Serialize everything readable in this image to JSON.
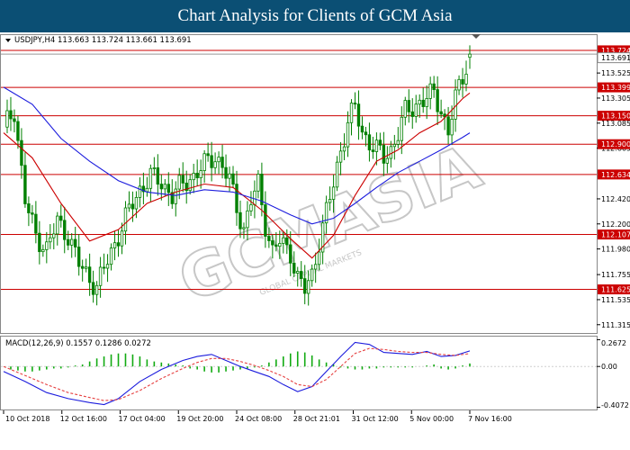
{
  "header": {
    "title": "Chart Analysis for Clients of GCM Asia"
  },
  "watermark": {
    "text": "GCMASIA",
    "subtext": "GLOBAL CAPITAL MARKETS"
  },
  "colors": {
    "header_bg": "#0b4f74",
    "candle": "#008000",
    "sma_fast": "#cc0000",
    "sma_slow": "#1c1cdd",
    "level_line": "#cc0000",
    "macd_hist": "#11aa11",
    "macd_signal": "#e64040"
  },
  "chart_data": [
    {
      "type": "candlestick",
      "header_text": "USDJPY,H4  113.663 113.724 113.661 113.691",
      "symbol": "USDJPY",
      "timeframe": "H4",
      "ohlc_last": {
        "open": 113.663,
        "high": 113.724,
        "low": 113.661,
        "close": 113.691
      },
      "ylim": [
        111.25,
        113.85
      ],
      "y_ticks": [
        "113.525",
        "113.305",
        "113.085",
        "112.865",
        "112.420",
        "112.200",
        "111.980",
        "111.755",
        "111.535",
        "111.315"
      ],
      "price_tags": [
        "113.724",
        "113.691",
        "113.399",
        "113.150",
        "112.900",
        "112.634",
        "112.107",
        "111.625"
      ],
      "horizontal_levels": [
        113.724,
        113.399,
        113.15,
        112.9,
        112.634,
        112.107,
        111.625
      ],
      "x_tick_labels": [
        "10 Oct 2018",
        "12 Oct 16:00",
        "17 Oct 04:00",
        "19 Oct 20:00",
        "24 Oct 08:00",
        "28 Oct 21:01",
        "31 Oct 12:00",
        "5 Nov 00:00",
        "7 Nov 16:00"
      ],
      "close_path": [
        [
          0,
          113.05
        ],
        [
          3,
          113.2
        ],
        [
          6,
          112.4
        ],
        [
          9,
          112.1
        ],
        [
          12,
          111.98
        ],
        [
          15,
          112.22
        ],
        [
          18,
          112.1
        ],
        [
          21,
          111.85
        ],
        [
          24,
          111.72
        ],
        [
          26,
          111.65
        ],
        [
          29,
          111.88
        ],
        [
          32,
          112.1
        ],
        [
          35,
          112.32
        ],
        [
          38,
          112.5
        ],
        [
          41,
          112.62
        ],
        [
          44,
          112.56
        ],
        [
          47,
          112.45
        ],
        [
          50,
          112.55
        ],
        [
          53,
          112.62
        ],
        [
          56,
          112.72
        ],
        [
          59,
          112.8
        ],
        [
          61,
          112.7
        ],
        [
          63,
          112.58
        ],
        [
          65,
          112.35
        ],
        [
          67,
          112.15
        ],
        [
          69,
          112.4
        ],
        [
          71,
          112.55
        ],
        [
          73,
          112.2
        ],
        [
          75,
          111.95
        ],
        [
          77,
          112.05
        ],
        [
          80,
          111.95
        ],
        [
          82,
          111.72
        ],
        [
          84,
          111.62
        ],
        [
          86,
          111.75
        ],
        [
          88,
          112.05
        ],
        [
          90,
          112.3
        ],
        [
          92,
          112.55
        ],
        [
          94,
          112.85
        ],
        [
          96,
          113.1
        ],
        [
          98,
          113.22
        ],
        [
          100,
          113.0
        ],
        [
          102,
          112.92
        ],
        [
          104,
          112.85
        ],
        [
          106,
          112.78
        ],
        [
          108,
          112.85
        ],
        [
          110,
          113.0
        ],
        [
          112,
          113.18
        ],
        [
          114,
          113.22
        ],
        [
          116,
          113.27
        ],
        [
          118,
          113.3
        ],
        [
          120,
          113.35
        ],
        [
          122,
          113.2
        ],
        [
          124,
          113.0
        ],
        [
          126,
          113.3
        ],
        [
          128,
          113.5
        ],
        [
          130,
          113.69
        ]
      ],
      "sma_fast_path": [
        [
          0,
          113.0
        ],
        [
          8,
          112.78
        ],
        [
          16,
          112.38
        ],
        [
          24,
          112.05
        ],
        [
          32,
          112.15
        ],
        [
          40,
          112.38
        ],
        [
          48,
          112.48
        ],
        [
          56,
          112.55
        ],
        [
          64,
          112.52
        ],
        [
          72,
          112.32
        ],
        [
          80,
          112.07
        ],
        [
          86,
          111.9
        ],
        [
          92,
          112.1
        ],
        [
          98,
          112.45
        ],
        [
          104,
          112.75
        ],
        [
          110,
          112.85
        ],
        [
          116,
          113.0
        ],
        [
          122,
          113.1
        ],
        [
          128,
          113.3
        ],
        [
          130,
          113.35
        ]
      ],
      "sma_slow_path": [
        [
          0,
          113.4
        ],
        [
          8,
          113.25
        ],
        [
          16,
          112.95
        ],
        [
          24,
          112.75
        ],
        [
          32,
          112.58
        ],
        [
          40,
          112.48
        ],
        [
          48,
          112.45
        ],
        [
          56,
          112.5
        ],
        [
          64,
          112.48
        ],
        [
          72,
          112.4
        ],
        [
          80,
          112.28
        ],
        [
          86,
          112.2
        ],
        [
          92,
          112.25
        ],
        [
          98,
          112.38
        ],
        [
          104,
          112.52
        ],
        [
          110,
          112.65
        ],
        [
          116,
          112.75
        ],
        [
          122,
          112.85
        ],
        [
          128,
          112.96
        ],
        [
          130,
          113.0
        ]
      ]
    },
    {
      "type": "macd",
      "header_text": "MACD(12,26,9)  0.1557 0.1286 0.0272",
      "params": [
        12,
        26,
        9
      ],
      "values": {
        "macd": 0.1557,
        "signal": 0.1286,
        "histogram": 0.0272
      },
      "ylim": [
        -0.42,
        0.28
      ],
      "y_ticks": [
        "0.2672",
        "0.00",
        "-0.4072"
      ],
      "macd_path": [
        [
          0,
          -0.05
        ],
        [
          6,
          -0.15
        ],
        [
          12,
          -0.26
        ],
        [
          18,
          -0.32
        ],
        [
          24,
          -0.36
        ],
        [
          28,
          -0.38
        ],
        [
          32,
          -0.32
        ],
        [
          38,
          -0.15
        ],
        [
          44,
          -0.03
        ],
        [
          50,
          0.06
        ],
        [
          54,
          0.1
        ],
        [
          58,
          0.12
        ],
        [
          62,
          0.06
        ],
        [
          66,
          0.0
        ],
        [
          70,
          -0.05
        ],
        [
          74,
          -0.1
        ],
        [
          78,
          -0.18
        ],
        [
          82,
          -0.25
        ],
        [
          86,
          -0.2
        ],
        [
          90,
          -0.05
        ],
        [
          94,
          0.1
        ],
        [
          98,
          0.24
        ],
        [
          102,
          0.22
        ],
        [
          106,
          0.14
        ],
        [
          110,
          0.13
        ],
        [
          114,
          0.12
        ],
        [
          118,
          0.15
        ],
        [
          122,
          0.1
        ],
        [
          126,
          0.11
        ],
        [
          130,
          0.155
        ]
      ],
      "signal_path": [
        [
          0,
          0.0
        ],
        [
          6,
          -0.09
        ],
        [
          12,
          -0.18
        ],
        [
          18,
          -0.26
        ],
        [
          24,
          -0.31
        ],
        [
          28,
          -0.34
        ],
        [
          32,
          -0.33
        ],
        [
          38,
          -0.24
        ],
        [
          44,
          -0.12
        ],
        [
          50,
          -0.02
        ],
        [
          54,
          0.04
        ],
        [
          58,
          0.08
        ],
        [
          62,
          0.08
        ],
        [
          66,
          0.05
        ],
        [
          70,
          0.01
        ],
        [
          74,
          -0.04
        ],
        [
          78,
          -0.1
        ],
        [
          82,
          -0.18
        ],
        [
          86,
          -0.2
        ],
        [
          90,
          -0.13
        ],
        [
          94,
          0.0
        ],
        [
          98,
          0.13
        ],
        [
          102,
          0.18
        ],
        [
          106,
          0.17
        ],
        [
          110,
          0.15
        ],
        [
          114,
          0.14
        ],
        [
          118,
          0.14
        ],
        [
          122,
          0.12
        ],
        [
          126,
          0.11
        ],
        [
          130,
          0.1286
        ]
      ],
      "histogram_bars": [
        [
          2,
          -0.03
        ],
        [
          4,
          -0.04
        ],
        [
          6,
          -0.05
        ],
        [
          8,
          -0.05
        ],
        [
          10,
          -0.04
        ],
        [
          12,
          -0.03
        ],
        [
          14,
          -0.02
        ],
        [
          16,
          -0.02
        ],
        [
          18,
          -0.01
        ],
        [
          20,
          0.01
        ],
        [
          22,
          0.02
        ],
        [
          24,
          0.05
        ],
        [
          26,
          0.08
        ],
        [
          28,
          0.1
        ],
        [
          30,
          0.12
        ],
        [
          32,
          0.13
        ],
        [
          34,
          0.13
        ],
        [
          36,
          0.12
        ],
        [
          38,
          0.1
        ],
        [
          40,
          0.07
        ],
        [
          42,
          0.05
        ],
        [
          44,
          0.04
        ],
        [
          46,
          0.03
        ],
        [
          48,
          0.02
        ],
        [
          50,
          0.01
        ],
        [
          52,
          -0.02
        ],
        [
          54,
          -0.03
        ],
        [
          56,
          -0.05
        ],
        [
          58,
          -0.06
        ],
        [
          60,
          -0.06
        ],
        [
          62,
          -0.05
        ],
        [
          64,
          -0.04
        ],
        [
          66,
          -0.03
        ],
        [
          68,
          -0.02
        ],
        [
          70,
          -0.01
        ],
        [
          72,
          0.01
        ],
        [
          74,
          0.04
        ],
        [
          76,
          0.07
        ],
        [
          78,
          0.1
        ],
        [
          80,
          0.13
        ],
        [
          82,
          0.15
        ],
        [
          84,
          0.14
        ],
        [
          86,
          0.11
        ],
        [
          88,
          0.07
        ],
        [
          90,
          0.04
        ],
        [
          92,
          0.02
        ],
        [
          94,
          -0.01
        ],
        [
          96,
          -0.02
        ],
        [
          98,
          -0.03
        ],
        [
          100,
          -0.03
        ],
        [
          102,
          -0.02
        ],
        [
          104,
          -0.02
        ],
        [
          106,
          -0.01
        ],
        [
          108,
          -0.01
        ],
        [
          110,
          -0.01
        ],
        [
          112,
          -0.01
        ],
        [
          114,
          -0.01
        ],
        [
          116,
          0.0
        ],
        [
          118,
          0.01
        ],
        [
          120,
          0.02
        ],
        [
          122,
          -0.02
        ],
        [
          124,
          -0.03
        ],
        [
          126,
          -0.02
        ],
        [
          128,
          0.01
        ],
        [
          130,
          0.03
        ]
      ]
    }
  ]
}
